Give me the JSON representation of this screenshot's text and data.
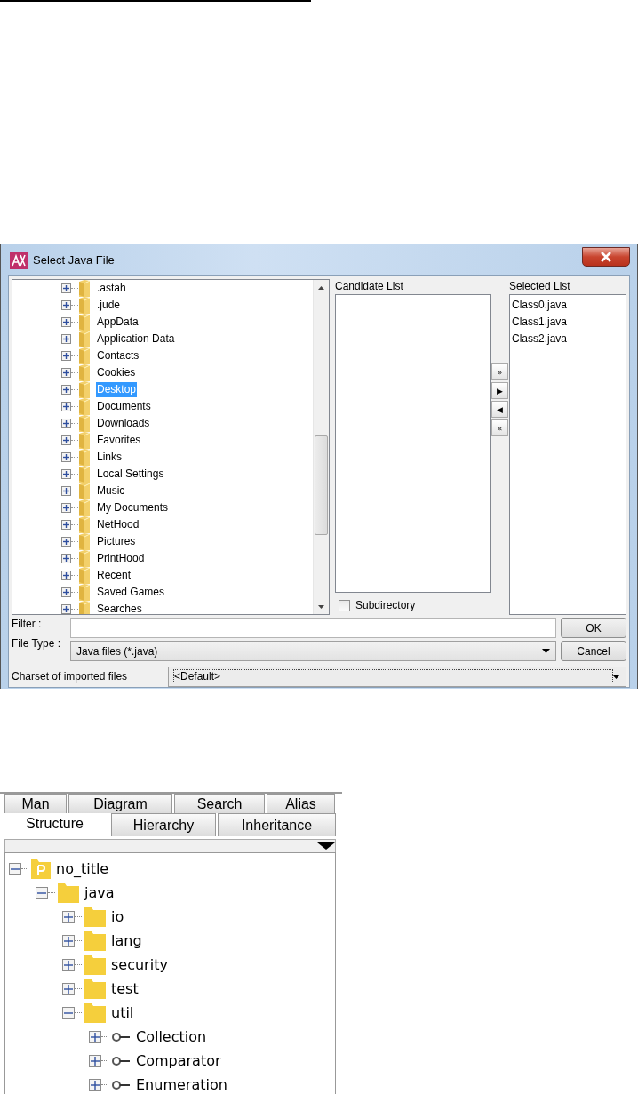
{
  "dialog": {
    "title": "Select Java File",
    "folder_tree": [
      {
        "label": ".astah",
        "selected": false
      },
      {
        "label": ".jude",
        "selected": false
      },
      {
        "label": "AppData",
        "selected": false
      },
      {
        "label": "Application Data",
        "selected": false
      },
      {
        "label": "Contacts",
        "selected": false
      },
      {
        "label": "Cookies",
        "selected": false
      },
      {
        "label": "Desktop",
        "selected": true
      },
      {
        "label": "Documents",
        "selected": false
      },
      {
        "label": "Downloads",
        "selected": false
      },
      {
        "label": "Favorites",
        "selected": false
      },
      {
        "label": "Links",
        "selected": false
      },
      {
        "label": "Local Settings",
        "selected": false
      },
      {
        "label": "Music",
        "selected": false
      },
      {
        "label": "My Documents",
        "selected": false
      },
      {
        "label": "NetHood",
        "selected": false
      },
      {
        "label": "Pictures",
        "selected": false
      },
      {
        "label": "PrintHood",
        "selected": false
      },
      {
        "label": "Recent",
        "selected": false
      },
      {
        "label": "Saved Games",
        "selected": false
      },
      {
        "label": "Searches",
        "selected": false
      }
    ],
    "candidate_list": {
      "label": "Candidate List"
    },
    "transfer_buttons": [
      "»",
      "▶",
      "◀",
      "«"
    ],
    "selected_list": {
      "label": "Selected List",
      "items": [
        "Class0.java",
        "Class1.java",
        "Class2.java"
      ]
    },
    "subdirectory": {
      "label": "Subdirectory",
      "checked": false
    },
    "filter": {
      "label": "Filter :"
    },
    "file_type": {
      "label": "File Type :",
      "value": "Java files (*.java)"
    },
    "buttons": [
      "OK",
      "Cancel"
    ],
    "charset": {
      "label": "Charset of imported files",
      "value": "<Default>"
    }
  },
  "structure_panel": {
    "tab_rows": [
      [
        {
          "label": "Man",
          "selected": false
        },
        {
          "label": "Diagram",
          "selected": false
        },
        {
          "label": "Search",
          "selected": false
        },
        {
          "label": "Alias",
          "selected": false
        }
      ],
      [
        {
          "label": "Structure",
          "selected": true
        },
        {
          "label": "Hierarchy",
          "selected": false
        },
        {
          "label": "Inheritance",
          "selected": false
        }
      ]
    ],
    "tree": [
      {
        "label": "no_title",
        "kind": "project",
        "expanded": true,
        "children": [
          {
            "label": "java",
            "kind": "package",
            "expanded": true,
            "children": [
              {
                "label": "io",
                "kind": "package",
                "expanded": false
              },
              {
                "label": "lang",
                "kind": "package",
                "expanded": false
              },
              {
                "label": "security",
                "kind": "package",
                "expanded": false
              },
              {
                "label": "test",
                "kind": "package",
                "expanded": false
              },
              {
                "label": "util",
                "kind": "package",
                "expanded": true,
                "children": [
                  {
                    "label": "Collection",
                    "kind": "interface",
                    "expanded": false
                  },
                  {
                    "label": "Comparator",
                    "kind": "interface",
                    "expanded": false
                  },
                  {
                    "label": "Enumeration",
                    "kind": "interface",
                    "expanded": false
                  }
                ]
              }
            ]
          }
        ]
      }
    ]
  }
}
